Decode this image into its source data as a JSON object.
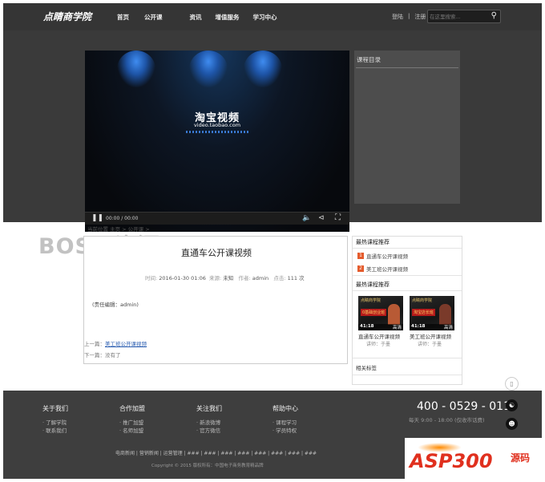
{
  "header": {
    "logo": "点睛商学院",
    "nav": [
      "首页",
      "公开课",
      "资讯",
      "增值服务",
      "学习中心"
    ],
    "login": "登陆",
    "sep": "|",
    "register": "注册",
    "search_placeholder": "在这里搜索..."
  },
  "video": {
    "logo_cn": "淘宝视频",
    "logo_en": "video.taobao.com",
    "time": "00:00 / 00:00"
  },
  "toc": {
    "title": "课程目录"
  },
  "breadcrumb": "当前位置  主页 >  公开课 >",
  "watermark": "BOSS 资源",
  "article": {
    "title": "直通车公开课视频",
    "time_label": "时间:",
    "time": "2016-01-30 01:06",
    "source_label": "来源:",
    "source": "未知",
    "author_label": "作者:",
    "author": "admin",
    "clicks_label": "点击:",
    "clicks": "111 次",
    "editor": "(责任编辑：admin)",
    "prev_label": "上一篇：",
    "prev_link": "美工班公开课视频",
    "next": "下一篇：没有了"
  },
  "sidebar": {
    "hot_title": "最热课程推荐",
    "hot_items": [
      {
        "num": "1",
        "label": "直通车公开课视频"
      },
      {
        "num": "2",
        "label": "美工班公开课视频"
      }
    ],
    "new_title": "最热课程推荐",
    "cards": [
      {
        "brand": "点睛商学院",
        "badge": "0基础创业班",
        "dur": "41:18",
        "tag": "高清",
        "title": "直通车公开课视频",
        "sub": "讲师：于墨"
      },
      {
        "brand": "点睛商学院",
        "badge": "淘宝店长班",
        "dur": "41:18",
        "tag": "高清",
        "title": "美工班公开课视频",
        "sub": "讲师：于墨"
      }
    ],
    "tags_title": "相关标签"
  },
  "footer": {
    "cols": [
      {
        "title": "关于我们",
        "items": [
          "· 了解学院",
          "· 联系我们"
        ]
      },
      {
        "title": "合作加盟",
        "items": [
          "· 推广加盟",
          "· 名师加盟"
        ]
      },
      {
        "title": "关注我们",
        "items": [
          "· 新浪微博",
          "· 官方微信"
        ]
      },
      {
        "title": "帮助中心",
        "items": [
          "· 课程学习",
          "· 学员特权"
        ]
      }
    ],
    "phone": "400 - 0529 - 011",
    "hours": "每天 9:00 - 18:00 (仅收市话费)",
    "links": "电商新闻  |  营销新闻  |  运营管理  |  ###  |  ###  |  ###  |  ###  |  ###  |  ###  |  ###  |  ###",
    "copyright": "Copyright © 2015 版权所有：中国电子商务教育精品牌"
  },
  "badge": {
    "text": "ASP300",
    "suffix": "源码"
  }
}
